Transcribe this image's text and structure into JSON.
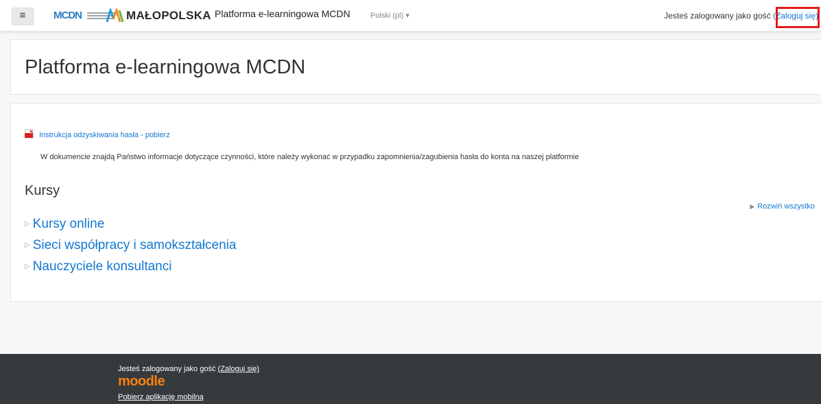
{
  "navbar": {
    "menu_icon": "hamburger-icon",
    "logo_mcdn": "MCDN",
    "logo_malopolska": "MAŁOPOLSKA",
    "site_name": "Platforma e-learningowa MCDN",
    "language": "Polski (pl) ▾",
    "login_prefix": "Jesteś zalogowany jako gość ",
    "login_link": "(Zaloguj się)"
  },
  "header": {
    "title": "Platforma e-learningowa MCDN"
  },
  "main": {
    "document_link": "Instrukcja odzyskiwania hasła - pobierz",
    "document_description": "W dokumencie znajdą Państwo informacje dotyczące czynności, które należy wykonać w przypadku zapomnienia/zagubienia hasła do konta na naszej platformie",
    "section_title": "Kursy",
    "expand_all": "Rozwiń wszystko",
    "categories": [
      "Kursy online",
      "Sieci współpracy i samokształcenia",
      "Nauczyciele konsultanci"
    ]
  },
  "footer": {
    "login_prefix": "Jesteś zalogowany jako gość ",
    "login_link": "(Zaloguj się)",
    "moodle_logo": "moodle",
    "mobile_app": "Pobierz aplikację mobilną"
  },
  "colors": {
    "link": "#1177d1",
    "highlight": "#e01b1b",
    "footer_bg": "#373a3c",
    "moodle": "#f98012"
  }
}
